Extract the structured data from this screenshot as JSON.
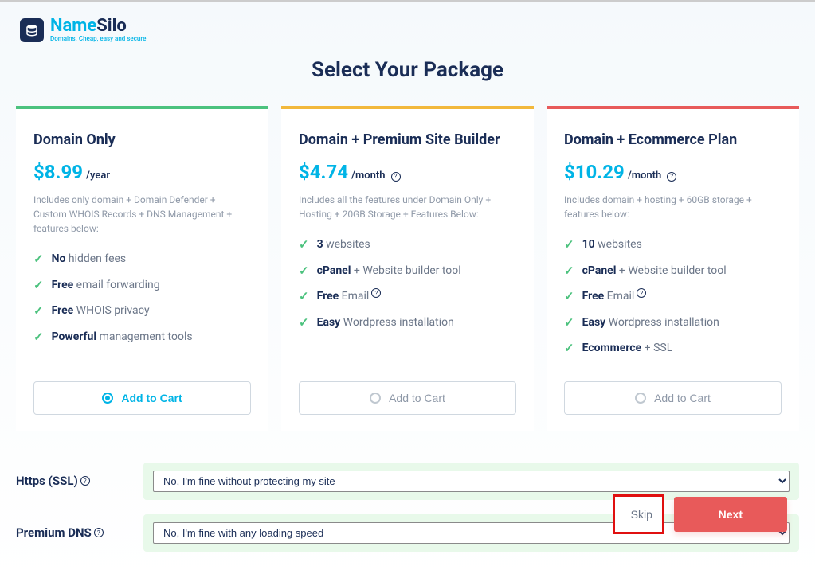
{
  "logo": {
    "name_first": "Name",
    "name_second": "Silo",
    "tagline": "Domains. Cheap, easy and secure"
  },
  "page_title": "Select Your Package",
  "packages": [
    {
      "title": "Domain Only",
      "price": "$8.99",
      "period": "/year",
      "desc": "Includes only domain + Domain Defender + Custom WHOIS Records + DNS Management + features below:",
      "features": [
        {
          "bold": "No",
          "text": " hidden fees"
        },
        {
          "bold": "Free",
          "text": " email forwarding"
        },
        {
          "bold": "Free",
          "text": " WHOIS privacy"
        },
        {
          "bold": "Powerful",
          "text": " management tools"
        }
      ],
      "cart_label": "Add to Cart",
      "selected": true
    },
    {
      "title": "Domain + Premium Site Builder",
      "price": "$4.74",
      "period": "/month",
      "has_help": true,
      "desc": "Includes all the features under Domain Only + Hosting + 20GB Storage + Features Below:",
      "features": [
        {
          "bold": "3",
          "text": " websites"
        },
        {
          "bold": "cPanel",
          "text": " + Website builder tool"
        },
        {
          "bold": "Free",
          "text": " Email",
          "help": true
        },
        {
          "bold": "Easy",
          "text": " Wordpress installation"
        }
      ],
      "cart_label": "Add to Cart",
      "selected": false
    },
    {
      "title": "Domain + Ecommerce Plan",
      "price": "$10.29",
      "period": "/month",
      "has_help": true,
      "desc": "Includes domain + hosting + 60GB storage + features below:",
      "features": [
        {
          "bold": "10",
          "text": " websites"
        },
        {
          "bold": "cPanel",
          "text": " + Website builder tool"
        },
        {
          "bold": "Free",
          "text": " Email",
          "help": true
        },
        {
          "bold": "Easy",
          "text": "  Wordpress installation"
        },
        {
          "bold": "Ecommerce",
          "text": " + SSL"
        }
      ],
      "cart_label": "Add to Cart",
      "selected": false
    }
  ],
  "options": {
    "ssl": {
      "label": "Https (SSL)",
      "value": "No, I'm fine without protecting my site"
    },
    "dns": {
      "label": "Premium DNS",
      "value": "No, I'm fine with any loading speed"
    }
  },
  "footer": {
    "skip": "Skip",
    "next": "Next"
  }
}
